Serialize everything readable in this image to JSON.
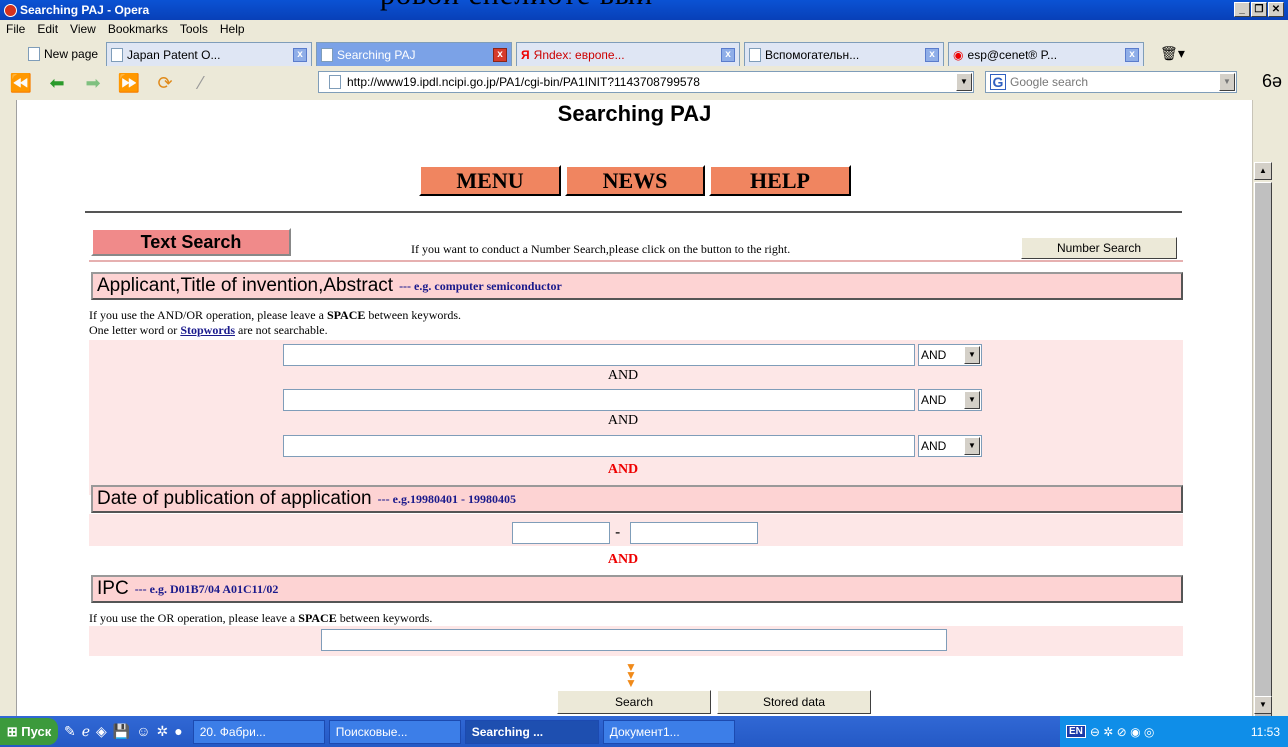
{
  "overlay_text": "ровой спелиоте вый",
  "window": {
    "title": "Searching PAJ - Opera"
  },
  "menu": [
    "File",
    "Edit",
    "View",
    "Bookmarks",
    "Tools",
    "Help"
  ],
  "tabs": [
    {
      "label": "New page",
      "close": ""
    },
    {
      "label": "Japan Patent O...",
      "close": "x"
    },
    {
      "label": "Searching PAJ",
      "close": "x"
    },
    {
      "label": "Яndex: европе...",
      "close": "x"
    },
    {
      "label": "Вспомогательн...",
      "close": "x"
    },
    {
      "label": "esp@cenet® P...",
      "close": "x"
    }
  ],
  "address": {
    "url": "http://www19.ipdl.ncipi.go.jp/PA1/cgi-bin/PA1INIT?1143708799578",
    "search_placeholder": "Google search"
  },
  "page": {
    "title": "Searching PAJ",
    "top_buttons": [
      "MENU",
      "NEWS",
      "HELP"
    ],
    "text_search_label": "Text Search",
    "number_search_hint": "If you want to conduct a Number Search,please click on the button to the right.",
    "number_search_button": "Number Search",
    "section1": {
      "heading": "Applicant,Title of invention,Abstract",
      "example": "--- e.g. computer semiconductor",
      "help1_pre": "If you use the AND/OR operation, please leave a ",
      "help1_bold": "SPACE",
      "help1_post": " between keywords.",
      "help2_pre": "One letter word or ",
      "help2_link": "Stopwords",
      "help2_post": " are not searchable.",
      "select_value": "AND",
      "connector": "AND"
    },
    "and_red": "AND",
    "section2": {
      "heading": "Date of publication of application",
      "example": "--- e.g.19980401 - 19980405",
      "dash": "-"
    },
    "section3": {
      "heading": "IPC",
      "example": "--- e.g. D01B7/04 A01C11/02",
      "help_pre": "If you use the OR operation, please leave a ",
      "help_bold": "SPACE",
      "help_post": " between keywords."
    },
    "search_button": "Search",
    "stored_button": "Stored data"
  },
  "taskbar": {
    "start": "Пуск",
    "tasks": [
      "20. Фабри...",
      "Поисковые...",
      "Searching ...",
      "Документ1..."
    ],
    "lang": "EN",
    "clock": "11:53"
  }
}
